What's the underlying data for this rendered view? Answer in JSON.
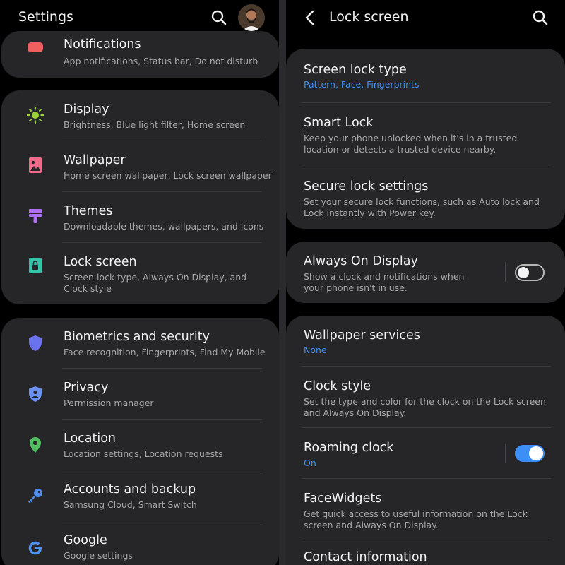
{
  "left": {
    "header": {
      "title": "Settings"
    },
    "notifications": {
      "title": "Notifications",
      "subtitle": "App notifications, Status bar, Do not disturb"
    },
    "group1": [
      {
        "title": "Display",
        "subtitle": "Brightness, Blue light filter, Home screen"
      },
      {
        "title": "Wallpaper",
        "subtitle": "Home screen wallpaper, Lock screen wallpaper"
      },
      {
        "title": "Themes",
        "subtitle": "Downloadable themes, wallpapers, and icons"
      },
      {
        "title": "Lock screen",
        "subtitle": "Screen lock type, Always On Display, and Clock style"
      }
    ],
    "group2": [
      {
        "title": "Biometrics and security",
        "subtitle": "Face recognition, Fingerprints, Find My Mobile"
      },
      {
        "title": "Privacy",
        "subtitle": "Permission manager"
      },
      {
        "title": "Location",
        "subtitle": "Location settings, Location requests"
      },
      {
        "title": "Accounts and backup",
        "subtitle": "Samsung Cloud, Smart Switch"
      },
      {
        "title": "Google",
        "subtitle": "Google settings"
      }
    ]
  },
  "right": {
    "header": {
      "title": "Lock screen"
    },
    "group1": [
      {
        "title": "Screen lock type",
        "subtitle": "Pattern, Face, Fingerprints"
      },
      {
        "title": "Smart Lock",
        "subtitle": "Keep your phone unlocked when it's in a trusted location or detects a trusted device nearby."
      },
      {
        "title": "Secure lock settings",
        "subtitle": "Set your secure lock functions, such as Auto lock and Lock instantly with Power key."
      }
    ],
    "always_on": {
      "title": "Always On Display",
      "subtitle": "Show a clock and notifications when your phone isn't in use.",
      "enabled": false
    },
    "group3": [
      {
        "title": "Wallpaper services",
        "subtitle": "None"
      },
      {
        "title": "Clock style",
        "subtitle": "Set the type and color for the clock on the Lock screen and Always On Display."
      },
      {
        "title": "Roaming clock",
        "subtitle": "On",
        "enabled": true
      },
      {
        "title": "FaceWidgets",
        "subtitle": "Get quick access to useful information on the Lock screen and Always On Display."
      },
      {
        "title": "Contact information",
        "subtitle": ""
      }
    ]
  },
  "colors": {
    "accent": "#3d8ef5",
    "toggle_on": "#3d8ef5",
    "card_bg": "#262629",
    "panel_bg": "#000000"
  }
}
